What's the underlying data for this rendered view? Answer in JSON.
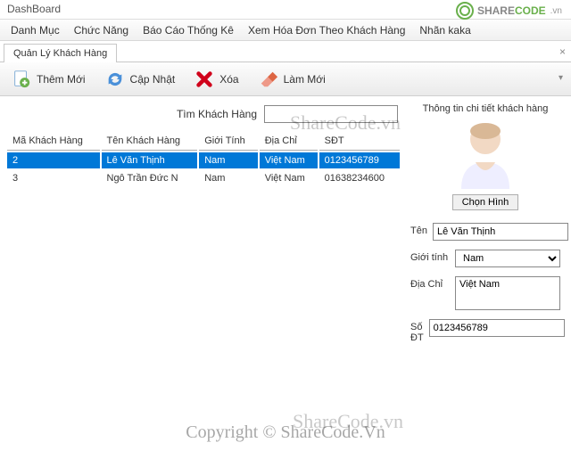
{
  "window": {
    "title": "DashBoard"
  },
  "menu": {
    "items": [
      "Danh Mục",
      "Chức Năng",
      "Báo Cáo Thống Kê",
      "Xem Hóa Đơn Theo Khách Hàng",
      "Nhãn kaka"
    ]
  },
  "logo": {
    "text_share": "SHARE",
    "text_code": "CODE",
    "vn": ".vn"
  },
  "tab": {
    "label": "Quản Lý Khách Hàng"
  },
  "toolbar": {
    "add": "Thêm Mới",
    "update": "Cập Nhật",
    "delete": "Xóa",
    "refresh": "Làm Mới"
  },
  "search": {
    "label": "Tìm Khách Hàng",
    "value": ""
  },
  "columns": [
    "Mã Khách Hàng",
    "Tên Khách Hàng",
    "Giới Tính",
    "Địa Chỉ",
    "SĐT"
  ],
  "rows": [
    {
      "id": "2",
      "name": "Lê Văn Thịnh",
      "gender": "Nam",
      "addr": "Việt Nam",
      "phone": "0123456789",
      "selected": true
    },
    {
      "id": "3",
      "name": "Ngô Trần Đức N",
      "gender": "Nam",
      "addr": "Việt Nam",
      "phone": "01638234600",
      "selected": false
    }
  ],
  "detail": {
    "heading": "Thông tin chi tiết khách hàng",
    "choose_img": "Chọn Hình",
    "name_lbl": "Tên",
    "name_val": "Lê Văn Thịnh",
    "gender_lbl": "Giới tính",
    "gender_val": "Nam",
    "addr_lbl": "Địa Chỉ",
    "addr_val": "Việt Nam",
    "phone_lbl": "Số ĐT",
    "phone_val": "0123456789"
  },
  "watermark": {
    "brand": "ShareCode.vn",
    "copyright": "Copyright © ShareCode.Vn"
  }
}
